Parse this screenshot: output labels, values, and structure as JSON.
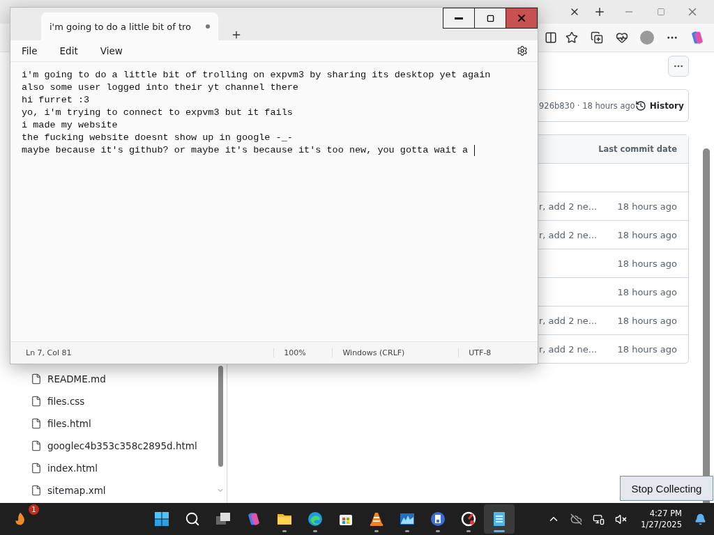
{
  "notepad": {
    "tab_title": "i'm going to do a little bit of tro",
    "unsaved": true,
    "menu": [
      "File",
      "Edit",
      "View"
    ],
    "lines": [
      "i'm going to do a little bit of trolling on expvm3 by sharing its desktop yet again",
      "also some user logged into their yt channel there",
      "hi furret :3",
      "yo, i'm trying to connect to expvm3 but it fails",
      "i made my website",
      "the fucking website doesnt show up in google -_-",
      "maybe because it's github? or maybe it's because it's too new, you gotta wait a"
    ],
    "status": {
      "position": "Ln 7, Col 81",
      "zoom": "100%",
      "line_ending": "Windows (CRLF)",
      "encoding": "UTF-8"
    }
  },
  "repo": {
    "commit_info": "926b830 · 18 hours ago",
    "history_label": "History",
    "column": "Last commit date",
    "rows": [
      {
        "message": "r, add 2 ne...",
        "date": "18 hours ago"
      },
      {
        "message": "r, add 2 ne...",
        "date": "18 hours ago"
      },
      {
        "date": "18 hours ago"
      },
      {
        "date": "18 hours ago"
      },
      {
        "message": "r, add 2 ne...",
        "date": "18 hours ago"
      },
      {
        "message": "r, add 2 ne...",
        "date": "18 hours ago"
      }
    ]
  },
  "files": [
    "README.md",
    "files.css",
    "files.html",
    "googlec4b353c358c2895d.html",
    "index.html",
    "sitemap.xml"
  ],
  "overlay_button": "Stop Collecting",
  "taskbar": {
    "badge": "1",
    "time": "4:27 PM",
    "date": "1/27/2025",
    "apps": [
      {
        "kind": "start",
        "running": false,
        "selected": false
      },
      {
        "kind": "search",
        "running": false,
        "selected": false
      },
      {
        "kind": "taskview",
        "running": false,
        "selected": false
      },
      {
        "kind": "copilot",
        "running": false,
        "selected": false
      },
      {
        "kind": "folder",
        "running": true,
        "selected": false
      },
      {
        "kind": "edge",
        "running": true,
        "selected": false
      },
      {
        "kind": "store",
        "running": false,
        "selected": false
      },
      {
        "kind": "cone",
        "running": true,
        "selected": false
      },
      {
        "kind": "monitor",
        "running": true,
        "selected": false
      },
      {
        "kind": "disk",
        "running": true,
        "selected": false
      },
      {
        "kind": "gauge",
        "running": true,
        "selected": false
      },
      {
        "kind": "notepad",
        "running": true,
        "selected": true
      }
    ]
  }
}
